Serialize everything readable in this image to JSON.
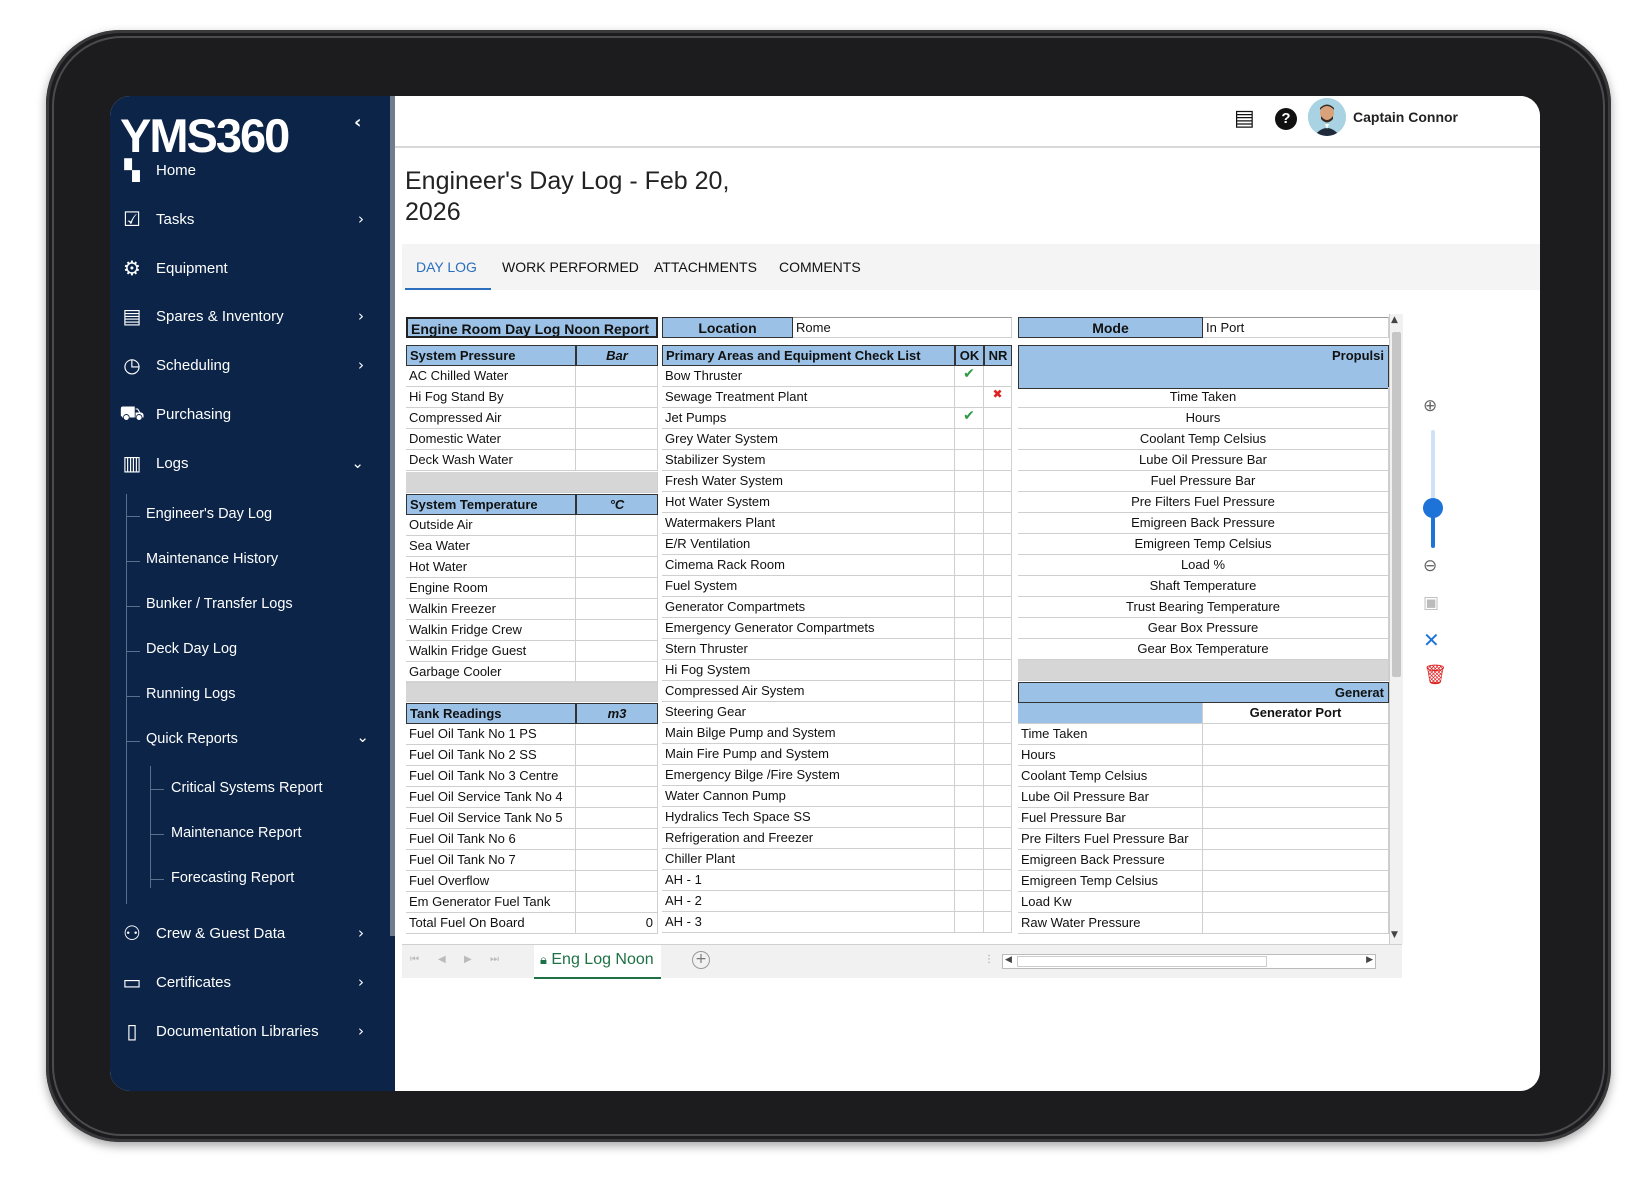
{
  "app": {
    "logo": "YMS360",
    "collapse_icon": "chevron-left-icon"
  },
  "sidebar": {
    "items": [
      {
        "label": "Home",
        "icon": "dashboard-icon",
        "chevron": ""
      },
      {
        "label": "Tasks",
        "icon": "clipboard-check-icon",
        "chevron": "›"
      },
      {
        "label": "Equipment",
        "icon": "gear-search-icon",
        "chevron": ""
      },
      {
        "label": "Spares & Inventory",
        "icon": "archive-icon",
        "chevron": "›"
      },
      {
        "label": "Scheduling",
        "icon": "calendar-clock-icon",
        "chevron": "›"
      },
      {
        "label": "Purchasing",
        "icon": "cart-icon",
        "chevron": ""
      },
      {
        "label": "Logs",
        "icon": "books-icon",
        "chevron": "⌄"
      },
      {
        "label": "Crew & Guest Data",
        "icon": "people-icon",
        "chevron": "›"
      },
      {
        "label": "Certificates",
        "icon": "folder-icon",
        "chevron": "›"
      },
      {
        "label": "Documentation Libraries",
        "icon": "document-icon",
        "chevron": "›"
      }
    ],
    "logs_sub": [
      "Engineer's Day Log",
      "Maintenance History",
      "Bunker / Transfer Logs",
      "Deck Day Log",
      "Running Logs",
      "Quick Reports"
    ],
    "quick_reports_sub": [
      "Critical Systems Report",
      "Maintenance Report",
      "Forecasting Report"
    ]
  },
  "topbar": {
    "user_name": "Captain Connor",
    "chat_icon": "chat-icon",
    "help_icon": "help-icon",
    "avatar": "avatar"
  },
  "page": {
    "title": "Engineer's Day Log - Feb 20, 2026"
  },
  "tabs": [
    "DAY LOG",
    "WORK PERFORMED",
    "ATTACHMENTS",
    "COMMENTS"
  ],
  "sheet": {
    "report_title": "Engine Room Day Log Noon Report",
    "location_label": "Location",
    "location_value": "Rome",
    "mode_label": "Mode",
    "mode_value": "In Port",
    "system_pressure": {
      "header": "System Pressure",
      "unit": "Bar",
      "rows": [
        "AC Chilled Water",
        "Hi Fog Stand By",
        "Compressed Air",
        "Domestic Water",
        "Deck Wash Water"
      ]
    },
    "system_temperature": {
      "header": "System Temperature",
      "unit": "°C",
      "rows": [
        "Outside Air",
        "Sea Water",
        "Hot Water",
        "Engine Room",
        "Walkin Freezer",
        "Walkin Fridge Crew",
        "Walkin Fridge Guest",
        "Garbage Cooler"
      ]
    },
    "tank_readings": {
      "header": "Tank Readings",
      "unit": "m3",
      "rows": [
        "Fuel Oil Tank No 1 PS",
        "Fuel Oil Tank No 2 SS",
        "Fuel Oil Tank No 3 Centre",
        "Fuel Oil Service Tank No 4",
        "Fuel Oil Service Tank No 5",
        "Fuel Oil Tank No 6",
        "Fuel Oil Tank No 7",
        "Fuel Overflow",
        "Em Generator Fuel Tank",
        "Total Fuel On Board"
      ],
      "total_value": "0"
    },
    "checklist": {
      "header": "Primary Areas and  Equipment Check List",
      "ok": "OK",
      "nr": "NR",
      "rows": [
        {
          "name": "Bow Thruster",
          "ok": "✔",
          "nr": ""
        },
        {
          "name": "Sewage Treatment Plant",
          "ok": "",
          "nr": "✖"
        },
        {
          "name": "Jet Pumps",
          "ok": "✔",
          "nr": ""
        },
        {
          "name": "Grey Water System",
          "ok": "",
          "nr": ""
        },
        {
          "name": "Stabilizer System",
          "ok": "",
          "nr": ""
        },
        {
          "name": "Fresh Water System",
          "ok": "",
          "nr": ""
        },
        {
          "name": "Hot Water System",
          "ok": "",
          "nr": ""
        },
        {
          "name": "Watermakers Plant",
          "ok": "",
          "nr": ""
        },
        {
          "name": "E/R Ventilation",
          "ok": "",
          "nr": ""
        },
        {
          "name": "Cimema Rack Room",
          "ok": "",
          "nr": ""
        },
        {
          "name": "Fuel System",
          "ok": "",
          "nr": ""
        },
        {
          "name": "Generator Compartmets",
          "ok": "",
          "nr": ""
        },
        {
          "name": "Emergency Generator Compartmets",
          "ok": "",
          "nr": ""
        },
        {
          "name": "Stern Thruster",
          "ok": "",
          "nr": ""
        },
        {
          "name": "Hi Fog System",
          "ok": "",
          "nr": ""
        },
        {
          "name": "Compressed Air System",
          "ok": "",
          "nr": ""
        },
        {
          "name": "Steering Gear",
          "ok": "",
          "nr": ""
        },
        {
          "name": "Main Bilge Pump and System",
          "ok": "",
          "nr": ""
        },
        {
          "name": "Main Fire Pump and System",
          "ok": "",
          "nr": ""
        },
        {
          "name": "Emergency Bilge /Fire System",
          "ok": "",
          "nr": ""
        },
        {
          "name": "Water Cannon Pump",
          "ok": "",
          "nr": ""
        },
        {
          "name": "Hydralics Tech Space SS",
          "ok": "",
          "nr": ""
        },
        {
          "name": "Refrigeration and Freezer",
          "ok": "",
          "nr": ""
        },
        {
          "name": "Chiller Plant",
          "ok": "",
          "nr": ""
        },
        {
          "name": "AH - 1",
          "ok": "",
          "nr": ""
        },
        {
          "name": "AH - 2",
          "ok": "",
          "nr": ""
        },
        {
          "name": "AH - 3",
          "ok": "",
          "nr": ""
        }
      ]
    },
    "propulsion": {
      "header": "Propulsi",
      "rows": [
        "Time Taken",
        "Hours",
        "Coolant Temp Celsius",
        "Lube Oil Pressure Bar",
        "Fuel Pressure Bar",
        "Pre Filters Fuel Pressure",
        "Emigreen Back Pressure",
        "Emigreen Temp Celsius",
        "Load %",
        "Shaft Temperature",
        "Trust Bearing Temperature",
        "Gear Box Pressure",
        "Gear Box Temperature"
      ]
    },
    "generator": {
      "header": "Generat",
      "port_label": "Generator Port",
      "rows": [
        "Time Taken",
        "Hours",
        "Coolant Temp Celsius",
        "Lube Oil Pressure Bar",
        "Fuel Pressure Bar",
        "Pre Filters Fuel Pressure Bar",
        "Emigreen Back Pressure",
        "Emigreen Temp Celsius",
        "Load Kw",
        "Raw Water Pressure"
      ]
    }
  },
  "sheet_tab": {
    "label": "Eng Log Noon",
    "lock_icon": "lock-icon"
  },
  "tools": [
    "zoom-in-icon",
    "zoom-out-icon",
    "save-icon",
    "close-icon",
    "trash-icon"
  ],
  "zoom_level": 0.35,
  "colors": {
    "sidebar": "#0b2447",
    "header_blue": "#9bc2e6",
    "accent": "#2a6ebd",
    "sheet_tab": "#1e7145"
  }
}
